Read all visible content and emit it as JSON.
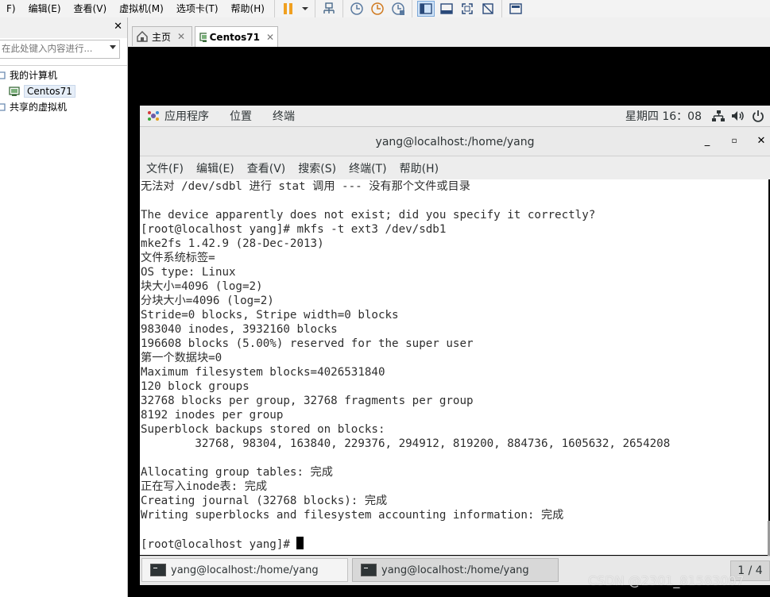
{
  "vmware": {
    "menu": [
      "F)",
      "编辑(E)",
      "查看(V)",
      "虚拟机(M)",
      "选项卡(T)",
      "帮助(H)"
    ],
    "accent": "#f0a020"
  },
  "library": {
    "search_placeholder": "在此处键入内容进行...",
    "tree": [
      "我的计算机",
      "Centos71",
      "共享的虚拟机"
    ]
  },
  "tabs": [
    {
      "label": "主页"
    },
    {
      "label": "Centos71"
    }
  ],
  "gnome": {
    "apps": "应用程序",
    "places": "位置",
    "terminal": "终端",
    "clock": "星期四 16：08"
  },
  "terminal": {
    "title": "yang@localhost:/home/yang",
    "menu": [
      "文件(F)",
      "编辑(E)",
      "查看(V)",
      "搜索(S)",
      "终端(T)",
      "帮助(H)"
    ],
    "lines": [
      "无法对 /dev/sdbl 进行 stat 调用 --- 没有那个文件或目录",
      "",
      "The device apparently does not exist; did you specify it correctly?",
      "[root@localhost yang]# mkfs -t ext3 /dev/sdb1",
      "mke2fs 1.42.9 (28-Dec-2013)",
      "文件系统标签=",
      "OS type: Linux",
      "块大小=4096 (log=2)",
      "分块大小=4096 (log=2)",
      "Stride=0 blocks, Stripe width=0 blocks",
      "983040 inodes, 3932160 blocks",
      "196608 blocks (5.00%) reserved for the super user",
      "第一个数据块=0",
      "Maximum filesystem blocks=4026531840",
      "120 block groups",
      "32768 blocks per group, 32768 fragments per group",
      "8192 inodes per group",
      "Superblock backups stored on blocks:",
      "        32768, 98304, 163840, 229376, 294912, 819200, 884736, 1605632, 2654208",
      "",
      "Allocating group tables: 完成",
      "正在写入inode表: 完成",
      "Creating journal (32768 blocks): 完成",
      "Writing superblocks and filesystem accounting information: 完成",
      "",
      "[root@localhost yang]# "
    ]
  },
  "taskbar": {
    "tasks": [
      "yang@localhost:/home/yang",
      "yang@localhost:/home/yang"
    ],
    "workspace": "1 / 4"
  },
  "watermark": "CSDN @2301_81583007"
}
